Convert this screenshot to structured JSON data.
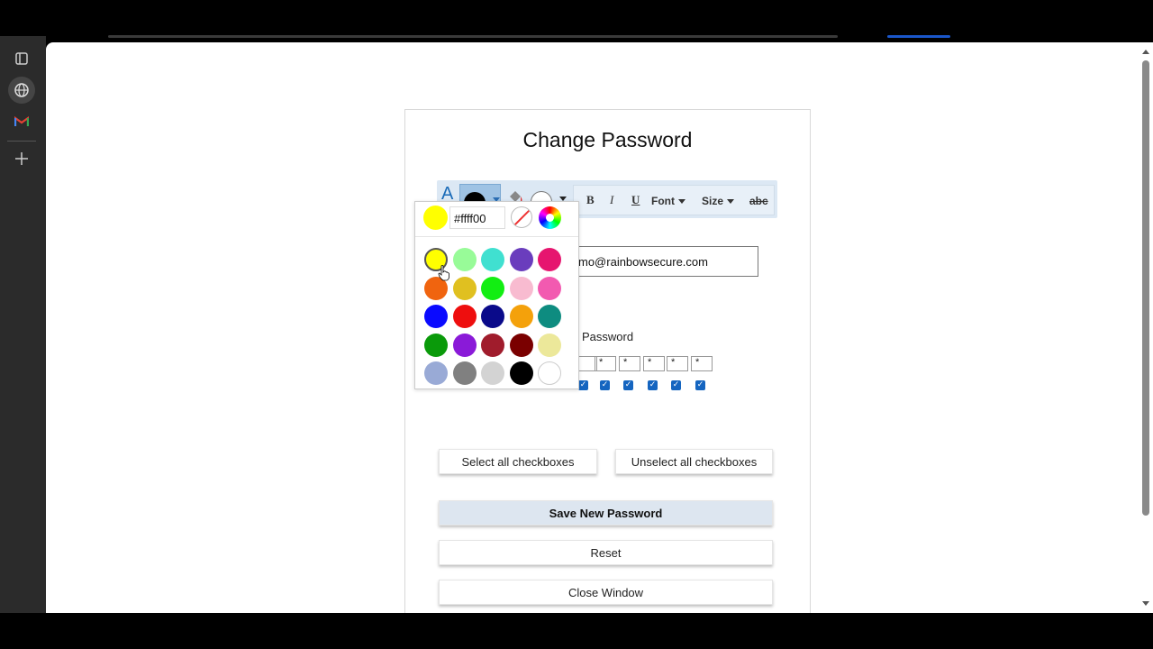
{
  "page": {
    "title": "Change Password",
    "email_value": "mo@rainbowsecure.com",
    "password_label": "Password",
    "password_mask": [
      "*",
      "*",
      "*",
      "*",
      "*"
    ],
    "buttons": {
      "select_all": "Select all checkboxes",
      "unselect_all": "Unselect all checkboxes",
      "save": "Save New Password",
      "reset": "Reset",
      "close": "Close Window"
    }
  },
  "toolbar": {
    "text_color_icon": "A",
    "bold": "B",
    "italic": "I",
    "underline": "U",
    "font_label": "Font",
    "size_label": "Size",
    "strike": "abc",
    "text_color_value": "#000000",
    "highlight_color_value": "#ffffff"
  },
  "color_picker": {
    "current_color": "#ffff00",
    "hex_value": "#ffff00",
    "swatches": [
      [
        "#ffff00",
        "#98fb98",
        "#40e0d0",
        "#6a3dbd",
        "#e6156f"
      ],
      [
        "#f0640f",
        "#e0c020",
        "#12ee12",
        "#f8bbd0",
        "#f25ab0"
      ],
      [
        "#0a0aff",
        "#ee0e0e",
        "#0a0a8a",
        "#f4a10b",
        "#0e8c80"
      ],
      [
        "#0a9a0a",
        "#8a1ad8",
        "#a01c2c",
        "#7a0000",
        "#ece89a"
      ],
      [
        "#99aad6",
        "#808080",
        "#d3d3d3",
        "#000000",
        "#ffffff"
      ]
    ],
    "selected": [
      0,
      0
    ]
  }
}
